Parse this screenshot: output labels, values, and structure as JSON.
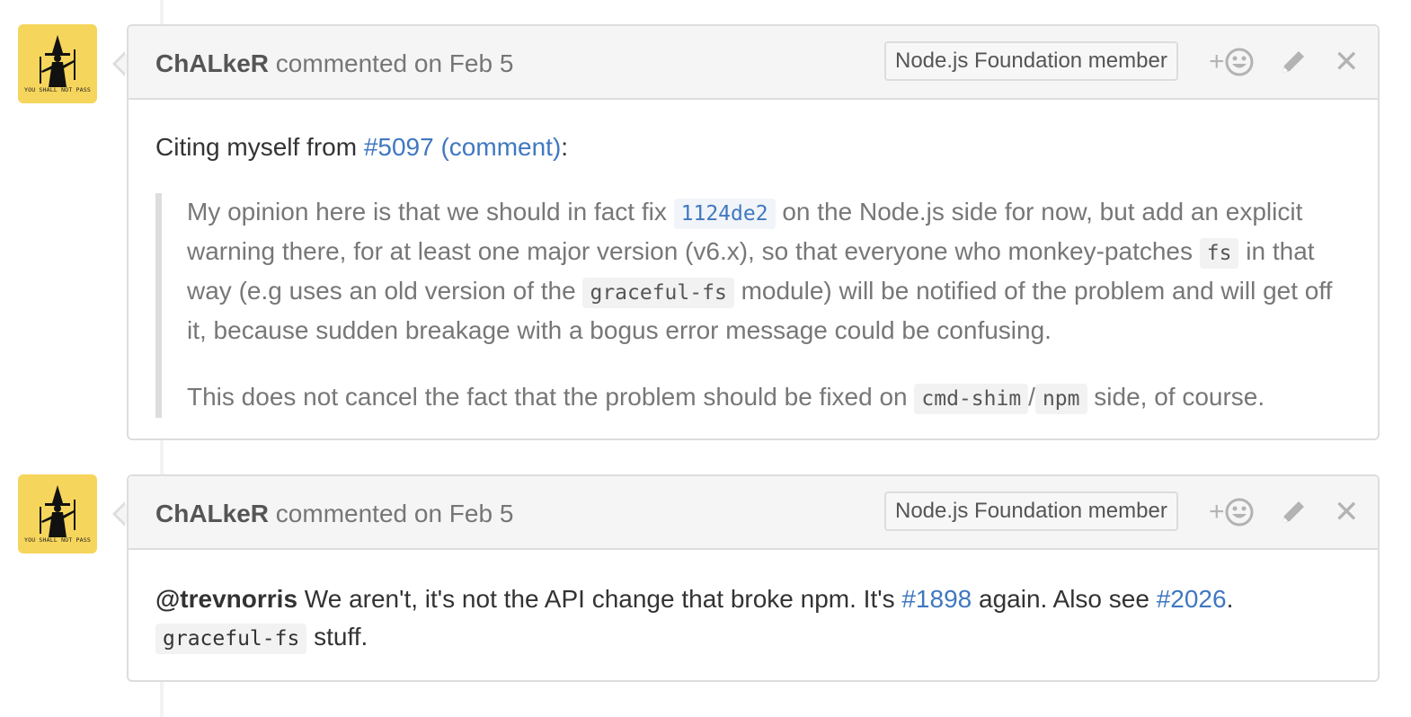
{
  "comments": [
    {
      "author": "ChALkeR",
      "action": "commented on Feb 5",
      "badge": "Node.js Foundation member",
      "avatar_caption": "YOU SHALL NOT PASS",
      "intro": {
        "prefix": "Citing myself from ",
        "link1": "#5097",
        "link2": "(comment)",
        "suffix": ":"
      },
      "quote": {
        "p1_a": "My opinion here is that we should in fact fix ",
        "p1_code1": "1124de2",
        "p1_b": " on the Node.js side for now, but add an explicit warning there, for at least one major version (v6.x), so that everyone who monkey-patches ",
        "p1_code2": "fs",
        "p1_c": " in that way (e.g uses an old version of the ",
        "p1_code3": "graceful-fs",
        "p1_d": " module) will be notified of the problem and will get off it, because sudden breakage with a bogus error message could be confusing.",
        "p2_a": "This does not cancel the fact that the problem should be fixed on ",
        "p2_code1": "cmd-shim",
        "p2_sep": "/",
        "p2_code2": "npm",
        "p2_b": " side, of course."
      }
    },
    {
      "author": "ChALkeR",
      "action": "commented on Feb 5",
      "badge": "Node.js Foundation member",
      "avatar_caption": "YOU SHALL NOT PASS",
      "body": {
        "mention": "@trevnorris",
        "text_a": " We aren't, it's not the API change that broke npm. It's ",
        "link1": "#1898",
        "text_b": " again. Also see ",
        "link2": "#2026",
        "text_c": ".",
        "code1": "graceful-fs",
        "text_d": " stuff."
      }
    }
  ],
  "actions": {
    "add_reaction": "+",
    "close": "✕"
  }
}
